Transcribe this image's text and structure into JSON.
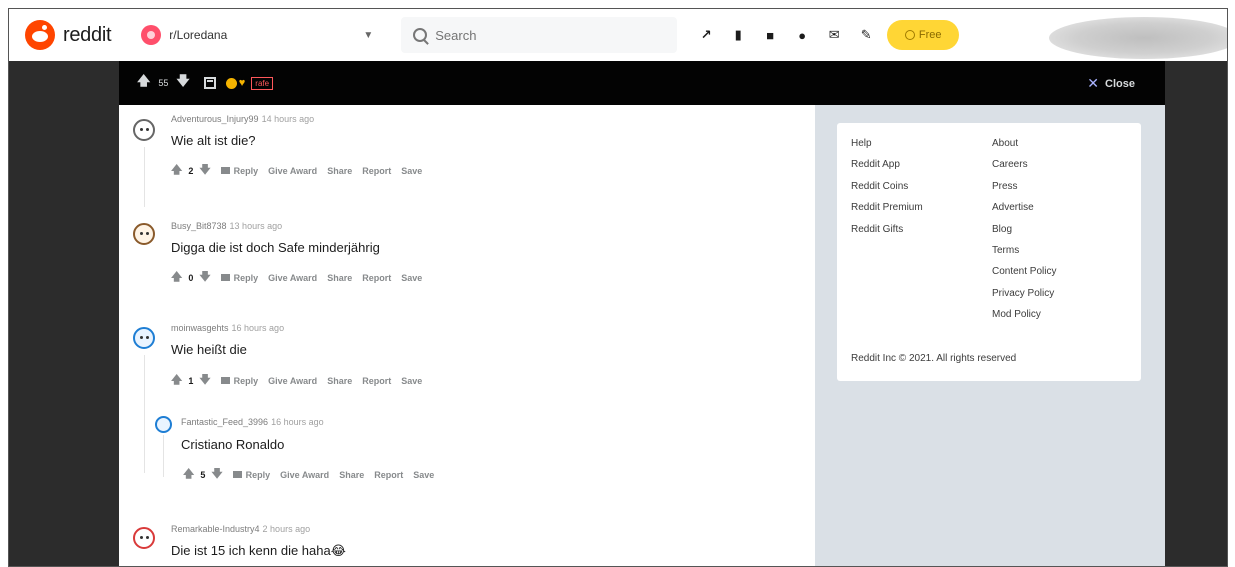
{
  "header": {
    "logo_text": "reddit",
    "community": "r/Loredana",
    "search_placeholder": "Search",
    "icons": [
      "trending-icon",
      "stats-icon",
      "coins-icon",
      "chat-icon",
      "mail-icon",
      "create-post-icon"
    ],
    "free_label": "Free"
  },
  "postbar": {
    "score": "55",
    "tag": "rafe",
    "close_label": "Close"
  },
  "comments": [
    {
      "user": "Adventurous_Injury99",
      "time": "14 hours ago",
      "text": "Wie alt ist die?",
      "score": "2"
    },
    {
      "user": "Busy_Bit8738",
      "time": "13 hours ago",
      "text": "Digga die ist doch Safe minderjährig",
      "score": "0"
    },
    {
      "user": "moinwasgehts",
      "time": "16 hours ago",
      "text": "Wie heißt die",
      "score": "1"
    },
    {
      "user": "Fantastic_Feed_3996",
      "time": "16 hours ago",
      "text": "Cristiano Ronaldo",
      "score": "5"
    },
    {
      "user": "Remarkable-Industry4",
      "time": "2 hours ago",
      "text": "Die ist 15 ich kenn die haha😂",
      "score": ""
    }
  ],
  "actions": {
    "reply": "Reply",
    "give_award": "Give Award",
    "share": "Share",
    "report": "Report",
    "save": "Save"
  },
  "footer": {
    "col1": [
      "Help",
      "Reddit App",
      "Reddit Coins",
      "Reddit Premium",
      "Reddit Gifts"
    ],
    "col2": [
      "About",
      "Careers",
      "Press",
      "Advertise",
      "Blog",
      "Terms",
      "Content Policy",
      "Privacy Policy",
      "Mod Policy"
    ],
    "copyright": "Reddit Inc © 2021. All rights reserved"
  }
}
